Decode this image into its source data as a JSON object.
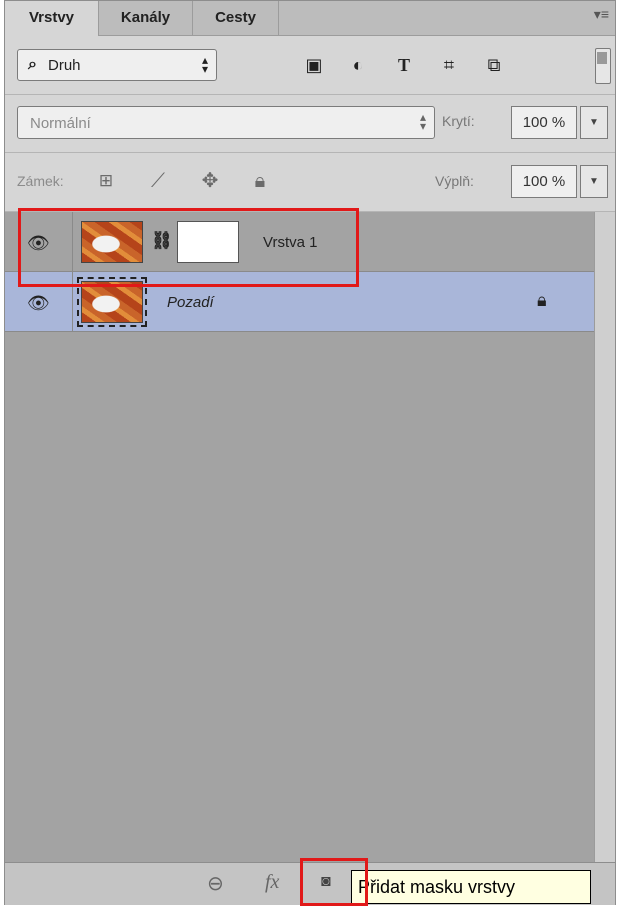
{
  "tabs": [
    {
      "label": "Vrstvy",
      "active": true
    },
    {
      "label": "Kanály",
      "active": false
    },
    {
      "label": "Cesty",
      "active": false
    }
  ],
  "filter": {
    "kind_label": "Druh",
    "icons": [
      "image-filter-icon",
      "adjustment-filter-icon",
      "type-filter-icon",
      "shape-filter-icon",
      "smart-object-filter-icon"
    ]
  },
  "blend": {
    "mode": "Normální",
    "opacity_label": "Krytí:",
    "opacity_value": "100 %"
  },
  "lock": {
    "label": "Zámek:",
    "fill_label": "Výplň:",
    "fill_value": "100 %"
  },
  "layers": [
    {
      "name": "Vrstva 1",
      "has_mask": true,
      "visible": true,
      "selected": false
    },
    {
      "name": "Pozadí",
      "has_mask": false,
      "visible": true,
      "selected": true,
      "locked": true
    }
  ],
  "tooltip": "Přidat masku vrstvy",
  "colors": {
    "panel_bg": "#d6d6d6",
    "selected_layer": "#a9b6d9",
    "highlight": "#e11919",
    "tooltip_bg": "#ffffe1"
  }
}
